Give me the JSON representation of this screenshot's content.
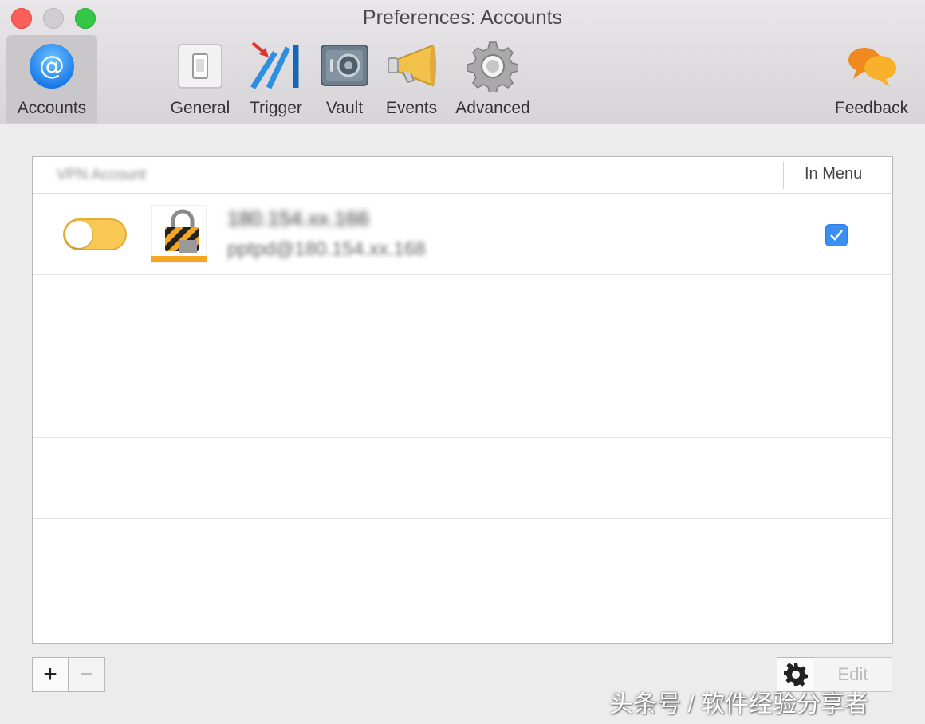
{
  "window": {
    "title": "Preferences: Accounts"
  },
  "toolbar": {
    "items": [
      {
        "label": "Accounts",
        "icon": "at-sign-icon",
        "selected": true
      },
      {
        "label": "General",
        "icon": "light-switch-icon"
      },
      {
        "label": "Trigger",
        "icon": "trigger-icon"
      },
      {
        "label": "Vault",
        "icon": "vault-icon"
      },
      {
        "label": "Events",
        "icon": "megaphone-icon"
      },
      {
        "label": "Advanced",
        "icon": "gear-icon"
      },
      {
        "label": "Feedback",
        "icon": "chat-bubbles-icon"
      }
    ]
  },
  "table": {
    "columns": {
      "name": "VPN Account",
      "in_menu": "In Menu"
    },
    "rows": [
      {
        "enabled": false,
        "name": "180.154.xx.166",
        "subtitle": "pptpd@180.154.xx.168",
        "in_menu": true
      }
    ]
  },
  "bottom": {
    "add_label": "+",
    "remove_label": "−",
    "edit_label": "Edit"
  },
  "watermark": "头条号 / 软件经验分享者",
  "colors": {
    "accent_blue": "#3b8ff3",
    "toggle_yellow": "#f8c754",
    "close_red": "#fc5f57",
    "maximize_green": "#33c748"
  }
}
